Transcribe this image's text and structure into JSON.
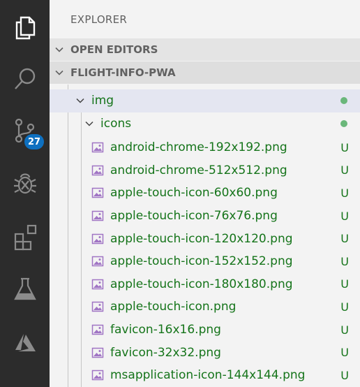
{
  "activity_bar": {
    "items": [
      {
        "name": "explorer",
        "icon": "files-icon"
      },
      {
        "name": "search",
        "icon": "search-icon"
      },
      {
        "name": "source-control",
        "icon": "source-control-icon",
        "badge": "27"
      },
      {
        "name": "debug",
        "icon": "debug-icon"
      },
      {
        "name": "extensions",
        "icon": "extensions-icon"
      },
      {
        "name": "testing",
        "icon": "flask-icon"
      },
      {
        "name": "azure",
        "icon": "azure-icon"
      }
    ]
  },
  "sidebar": {
    "title": "EXPLORER",
    "sections": {
      "open_editors": "OPEN EDITORS",
      "project": "FLIGHT-INFO-PWA"
    },
    "folders": {
      "img": "img",
      "icons": "icons"
    },
    "files": [
      {
        "name": "android-chrome-192x192.png",
        "status": "U"
      },
      {
        "name": "android-chrome-512x512.png",
        "status": "U"
      },
      {
        "name": "apple-touch-icon-60x60.png",
        "status": "U"
      },
      {
        "name": "apple-touch-icon-76x76.png",
        "status": "U"
      },
      {
        "name": "apple-touch-icon-120x120.png",
        "status": "U"
      },
      {
        "name": "apple-touch-icon-152x152.png",
        "status": "U"
      },
      {
        "name": "apple-touch-icon-180x180.png",
        "status": "U"
      },
      {
        "name": "apple-touch-icon.png",
        "status": "U"
      },
      {
        "name": "favicon-16x16.png",
        "status": "U"
      },
      {
        "name": "favicon-32x32.png",
        "status": "U"
      },
      {
        "name": "msapplication-icon-144x144.png",
        "status": "U"
      }
    ]
  },
  "colors": {
    "activity_bg": "#2c2c2c",
    "badge_bg": "#0e70c0",
    "untracked_text": "#15741a",
    "selected_row": "#e4e6f1",
    "image_icon": "#a074c4"
  }
}
